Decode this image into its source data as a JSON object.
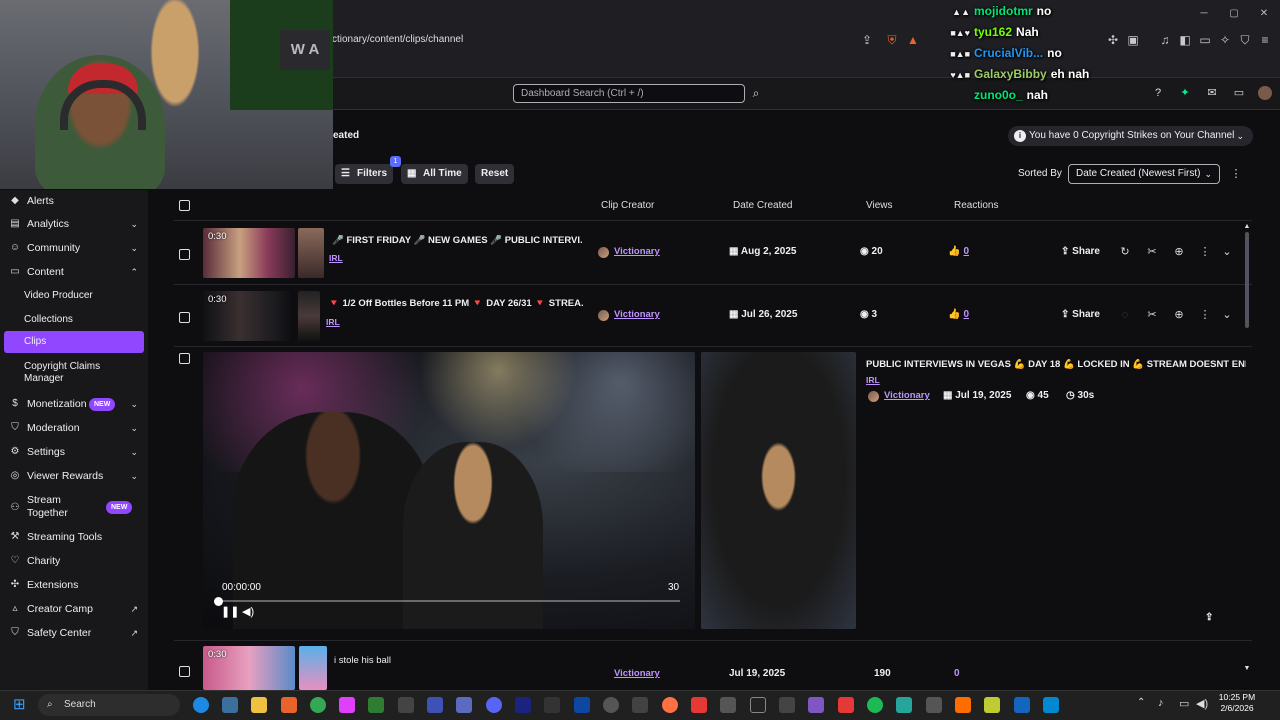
{
  "browser": {
    "address": "ctionary/content/clips/channel",
    "window_controls": [
      "minimize-icon",
      "maximize-icon",
      "close-icon"
    ]
  },
  "header": {
    "search_placeholder": "Dashboard Search (Ctrl + /)"
  },
  "chat": [
    {
      "user": "mojidotmr",
      "color": "#00e676",
      "message": "no"
    },
    {
      "user": "tyu162",
      "color": "#76ff03",
      "message": "Nah"
    },
    {
      "user": "CrucialVib...",
      "color": "#2196f3",
      "message": "no"
    },
    {
      "user": "GalaxyBibby",
      "color": "#9ccc65",
      "message": "eh nah"
    },
    {
      "user": "zuno0o_",
      "color": "#00e676",
      "message": "nah"
    }
  ],
  "sidebar": {
    "items": [
      {
        "label": "Alerts",
        "icon": "bell-icon"
      },
      {
        "label": "Analytics",
        "icon": "chart-icon"
      },
      {
        "label": "Community",
        "icon": "people-icon"
      },
      {
        "label": "Content",
        "icon": "content-icon"
      },
      {
        "label": "Monetization",
        "icon": "dollar-icon",
        "badge": "NEW"
      },
      {
        "label": "Moderation",
        "icon": "shield-icon"
      },
      {
        "label": "Settings",
        "icon": "gear-icon"
      },
      {
        "label": "Viewer Rewards",
        "icon": "reward-icon"
      },
      {
        "label": "Stream Together",
        "icon": "stream-together-icon",
        "badge": "NEW"
      },
      {
        "label": "Streaming Tools",
        "icon": "tools-icon"
      },
      {
        "label": "Charity",
        "icon": "heart-icon"
      },
      {
        "label": "Extensions",
        "icon": "puzzle-icon"
      },
      {
        "label": "Creator Camp",
        "icon": "camp-icon"
      },
      {
        "label": "Safety Center",
        "icon": "safety-icon"
      }
    ],
    "content_sub": [
      "Video Producer",
      "Collections",
      "Clips",
      "Copyright Claims Manager"
    ]
  },
  "main": {
    "title_fragment": "eated",
    "strikes": "You have 0 Copyright Strikes on Your Channel",
    "filters_label": "Filters",
    "filters_count": "1",
    "time_label": "All Time",
    "reset_label": "Reset",
    "sorted_by_label": "Sorted By",
    "sort_value": "Date Created (Newest First)",
    "columns": [
      "Clip Creator",
      "Date Created",
      "Views",
      "Reactions"
    ],
    "share_label": "Share"
  },
  "clips": [
    {
      "duration": "0:30",
      "title": "🎤 FIRST FRIDAY 🎤 NEW GAMES 🎤 PUBLIC INTERVI...",
      "category": "IRL",
      "creator": "Victionary",
      "date": "Aug 2, 2025",
      "views": "20",
      "reactions": "0"
    },
    {
      "duration": "0:30",
      "title": "🔻 1/2 Off Bottles Before 11 PM 🔻 DAY 26/31 🔻 STREA...",
      "category": "IRL",
      "creator": "Victionary",
      "date": "Jul 26, 2025",
      "views": "3",
      "reactions": "0"
    },
    {
      "title": "PUBLIC INTERVIEWS IN VEGAS 💪 DAY 18 💪 LOCKED IN 💪 STREAM DOESNT END-",
      "category": "IRL",
      "creator": "Victionary",
      "date": "Jul 19, 2025",
      "views": "45",
      "length": "30s",
      "time_current": "00:00:00",
      "time_end": "30",
      "progress": 0
    },
    {
      "duration": "0:30",
      "title": "i stole his ball",
      "creator": "Victionary",
      "date": "Jul 19, 2025",
      "views": "190",
      "reactions": "0"
    }
  ],
  "taskbar": {
    "search_label": "Search",
    "time": "10:25 PM",
    "date": "2/6/2026"
  }
}
